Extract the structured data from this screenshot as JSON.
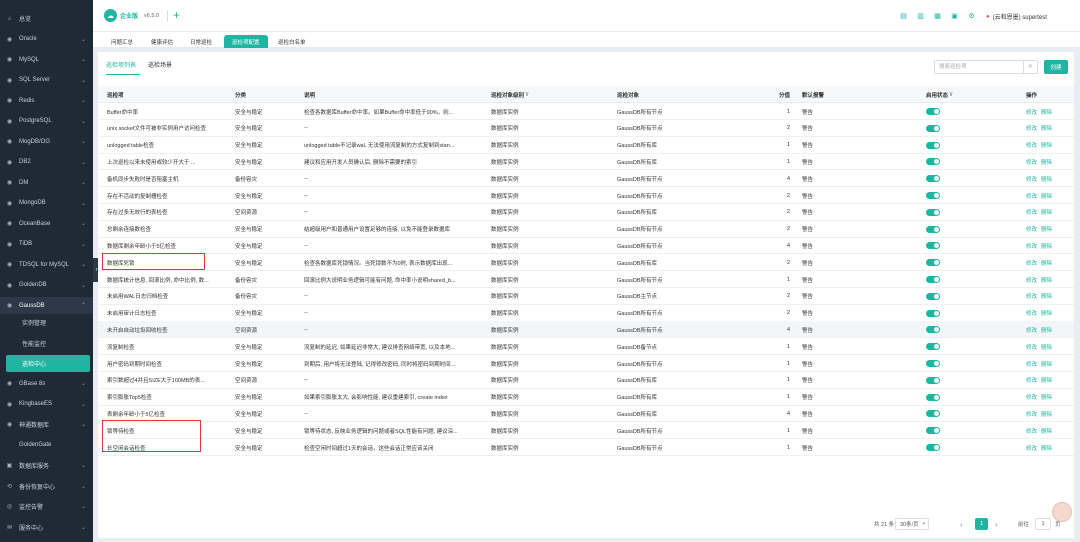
{
  "sidebar": {
    "items": [
      {
        "label": "总览",
        "icon": "home-icon",
        "chev": false
      },
      {
        "label": "Oracle",
        "icon": "database-icon",
        "chev": true
      },
      {
        "label": "MySQL",
        "icon": "database-icon",
        "chev": true
      },
      {
        "label": "SQL Server",
        "icon": "database-icon",
        "chev": true
      },
      {
        "label": "Redis",
        "icon": "database-icon",
        "chev": true
      },
      {
        "label": "PostgreSQL",
        "icon": "database-icon",
        "chev": true
      },
      {
        "label": "MogDB/OG",
        "icon": "database-icon",
        "chev": true
      },
      {
        "label": "DB2",
        "icon": "database-icon",
        "chev": true
      },
      {
        "label": "DM",
        "icon": "database-icon",
        "chev": true
      },
      {
        "label": "MongoDB",
        "icon": "database-icon",
        "chev": true
      },
      {
        "label": "OceanBase",
        "icon": "database-icon",
        "chev": true
      },
      {
        "label": "TiDB",
        "icon": "database-icon",
        "chev": true
      },
      {
        "label": "TDSQL for MySQL",
        "icon": "database-icon",
        "chev": true
      },
      {
        "label": "GoldenDB",
        "icon": "database-icon",
        "chev": true
      },
      {
        "label": "GaussDB",
        "icon": "database-icon",
        "chev": true
      }
    ],
    "gauss_sub": [
      "实例管理",
      "性能监控",
      "巡检中心"
    ],
    "items_after": [
      {
        "label": "GBase 8s",
        "icon": "database-icon",
        "chev": true
      },
      {
        "label": "KingbaseES",
        "icon": "database-icon",
        "chev": true
      },
      {
        "label": "神通数据库",
        "icon": "database-icon",
        "chev": true
      },
      {
        "label": "GoldenGate",
        "icon": "",
        "chev": false
      },
      {
        "label": "数据库服务",
        "icon": "server-icon",
        "chev": true
      },
      {
        "label": "备份恢复中心",
        "icon": "backup-icon",
        "chev": true
      },
      {
        "label": "监控告警",
        "icon": "alarm-icon",
        "chev": true
      },
      {
        "label": "服务中心",
        "icon": "service-icon",
        "chev": true
      }
    ]
  },
  "header": {
    "app_name": "企业版",
    "version": "v6.5.0",
    "user": "(云和恩墨) supertest"
  },
  "tabs": [
    "问题汇总",
    "健康评估",
    "日常巡检",
    "巡检项配置",
    "巡检白名单"
  ],
  "subtabs": [
    "巡检项列表",
    "巡检场景"
  ],
  "search": {
    "placeholder": "搜索巡检项"
  },
  "create_label": "创建",
  "columns": [
    "巡检项",
    "分类",
    "说明",
    "巡检对象级别",
    "巡检对象",
    "分值",
    "默认报警",
    "启用状态",
    "操作"
  ],
  "rows": [
    {
      "name": "Buffer命中率",
      "cat": "安全与稳定",
      "desc": "检查各数据库Buffer命中率。如果Buffer命中率低于90%，则...",
      "level": "数据库实例",
      "target": "GaussDB所有节点",
      "score": "1",
      "alarm": "警告"
    },
    {
      "name": "unix socket文件可被非实例用户访问检查",
      "cat": "安全与稳定",
      "desc": "--",
      "level": "数据库实例",
      "target": "GaussDB所有节点",
      "score": "2",
      "alarm": "警告"
    },
    {
      "name": "unlogged table检查",
      "cat": "安全与稳定",
      "desc": "unlogged table不记录wal, 无法使用流复制的方式复制到stan...",
      "level": "数据库实例",
      "target": "GaussDB所有库",
      "score": "1",
      "alarm": "警告"
    },
    {
      "name": "上次巡检以来未使用或较少开大于 ...",
      "cat": "安全与稳定",
      "desc": "建议和应用开发人员确认后, 删除不需要的索引",
      "level": "数据库实例",
      "target": "GaussDB所有库",
      "score": "1",
      "alarm": "警告"
    },
    {
      "name": "备机同步失败时是否阻塞主机",
      "cat": "备份容灾",
      "desc": "--",
      "level": "数据库实例",
      "target": "GaussDB所有节点",
      "score": "4",
      "alarm": "警告"
    },
    {
      "name": "存在不活动的复制槽检查",
      "cat": "安全与稳定",
      "desc": "--",
      "level": "数据库实例",
      "target": "GaussDB所有节点",
      "score": "2",
      "alarm": "警告"
    },
    {
      "name": "存在过多无效行的表检查",
      "cat": "空间资源",
      "desc": "--",
      "level": "数据库实例",
      "target": "GaussDB所有库",
      "score": "2",
      "alarm": "警告"
    },
    {
      "name": "总剩余连接数检查",
      "cat": "安全与稳定",
      "desc": "结超级用户和普通用户设置足够的连接, 以免不能登录数据库",
      "level": "数据库实例",
      "target": "GaussDB所有节点",
      "score": "2",
      "alarm": "警告"
    },
    {
      "name": "数据库剩余年龄小于5亿检查",
      "cat": "安全与稳定",
      "desc": "--",
      "level": "数据库实例",
      "target": "GaussDB所有节点",
      "score": "4",
      "alarm": "警告"
    },
    {
      "name": "数据库死锁",
      "cat": "安全与稳定",
      "desc": "检查各数据库死锁情况。当死锁数不为0时, 表示数据库出现...",
      "level": "数据库实例",
      "target": "GaussDB所有库",
      "score": "2",
      "alarm": "警告"
    },
    {
      "name": "数据库统计信息, 回滚比例, 命中比例, 数...",
      "cat": "备份容灾",
      "desc": "回滚比例大说明业务逻辑可能有问题, 命中率小说明shared_b...",
      "level": "数据库实例",
      "target": "GaussDB所有节点",
      "score": "1",
      "alarm": "警告"
    },
    {
      "name": "未启用WAL日志归档检查",
      "cat": "备份容灾",
      "desc": "--",
      "level": "数据库实例",
      "target": "GaussDB主节点",
      "score": "2",
      "alarm": "警告"
    },
    {
      "name": "未启用审计日志检查",
      "cat": "安全与稳定",
      "desc": "--",
      "level": "数据库实例",
      "target": "GaussDB所有节点",
      "score": "2",
      "alarm": "警告"
    },
    {
      "name": "未开启自动垃圾回收检查",
      "cat": "空间资源",
      "desc": "--",
      "level": "数据库实例",
      "target": "GaussDB所有节点",
      "score": "4",
      "alarm": "警告"
    },
    {
      "name": "流复制检查",
      "cat": "安全与稳定",
      "desc": "流复制的延迟, 如果延迟非常大, 建议排查网络带宽, 以及本地...",
      "level": "数据库实例",
      "target": "GaussDB备节点",
      "score": "1",
      "alarm": "警告"
    },
    {
      "name": "用户密码到期时间检查",
      "cat": "安全与稳定",
      "desc": "到期后, 用户将无法登陆, 记得修改密码, 同时将密码到期时间...",
      "level": "数据库实例",
      "target": "GaussDB所有节点",
      "score": "1",
      "alarm": "警告"
    },
    {
      "name": "索引数超过4并且SIZE大于100MB的表...",
      "cat": "空间资源",
      "desc": "--",
      "level": "数据库实例",
      "target": "GaussDB所有库",
      "score": "1",
      "alarm": "警告"
    },
    {
      "name": "索引膨胀Top5检查",
      "cat": "安全与稳定",
      "desc": "如果索引膨胀太大, 会影响性能, 建议重建索引, create index",
      "level": "数据库实例",
      "target": "GaussDB所有库",
      "score": "1",
      "alarm": "警告"
    },
    {
      "name": "表剩余年龄小于5亿检查",
      "cat": "安全与稳定",
      "desc": "--",
      "level": "数据库实例",
      "target": "GaussDB所有库",
      "score": "4",
      "alarm": "警告"
    },
    {
      "name": "锁等待检查",
      "cat": "安全与稳定",
      "desc": "锁等待状态, 反映业务逻辑的问题或者SQL性能有问题, 建议深...",
      "level": "数据库实例",
      "target": "GaussDB所有节点",
      "score": "1",
      "alarm": "警告"
    },
    {
      "name": "长空闲会话检查",
      "cat": "安全与稳定",
      "desc": "检查空闲时间超过1天的会话，这些会话正常应该关闭",
      "level": "数据库实例",
      "target": "GaussDB所有节点",
      "score": "1",
      "alarm": "警告"
    }
  ],
  "actions": {
    "edit": "修改",
    "delete": "删除"
  },
  "pager": {
    "total": "共 21 条",
    "size": "30条/页",
    "prev": "‹",
    "current": "1",
    "next": "›",
    "goto": "前往",
    "goto_value": "1",
    "page_unit": "页"
  }
}
